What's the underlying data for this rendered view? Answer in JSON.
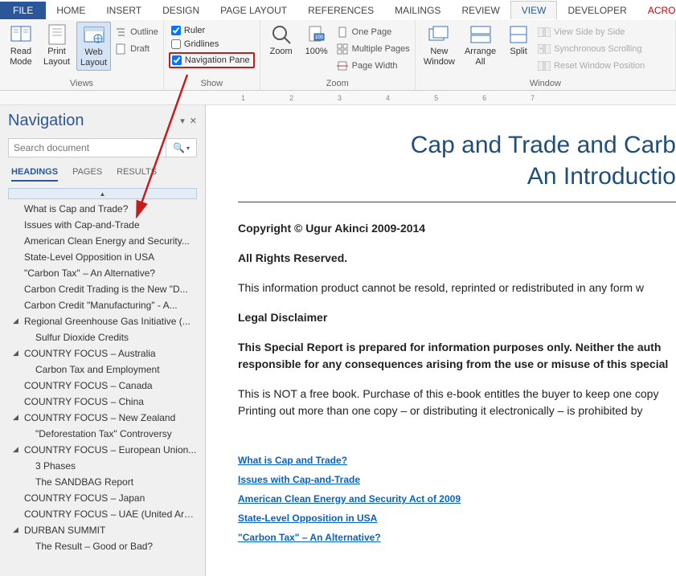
{
  "tabs": {
    "file": "FILE",
    "home": "HOME",
    "insert": "INSERT",
    "design": "DESIGN",
    "page_layout": "PAGE LAYOUT",
    "references": "REFERENCES",
    "mailings": "MAILINGS",
    "review": "REVIEW",
    "view": "VIEW",
    "developer": "DEVELOPER",
    "acrobat": "ACROBAT"
  },
  "ribbon": {
    "views": {
      "read_mode": "Read\nMode",
      "print_layout": "Print\nLayout",
      "web_layout": "Web\nLayout",
      "outline": "Outline",
      "draft": "Draft",
      "label": "Views"
    },
    "show": {
      "ruler": "Ruler",
      "gridlines": "Gridlines",
      "nav_pane": "Navigation Pane",
      "label": "Show"
    },
    "zoom": {
      "zoom": "Zoom",
      "pct": "100%",
      "one_page": "One Page",
      "multi_pages": "Multiple Pages",
      "page_width": "Page Width",
      "label": "Zoom"
    },
    "window": {
      "new_window": "New\nWindow",
      "arrange_all": "Arrange\nAll",
      "split": "Split",
      "side_by_side": "View Side by Side",
      "sync_scroll": "Synchronous Scrolling",
      "reset_pos": "Reset Window Position",
      "label": "Window"
    }
  },
  "ruler_marks": [
    "1",
    "2",
    "3",
    "4",
    "5",
    "6",
    "7"
  ],
  "nav": {
    "title": "Navigation",
    "search_placeholder": "Search document",
    "tabs": {
      "headings": "HEADINGS",
      "pages": "PAGES",
      "results": "RESULTS"
    },
    "items": [
      {
        "label": "What is Cap and Trade?",
        "level": 0
      },
      {
        "label": "Issues with Cap-and-Trade",
        "level": 0
      },
      {
        "label": "American Clean Energy and Security...",
        "level": 0
      },
      {
        "label": "State-Level Opposition in USA",
        "level": 0
      },
      {
        "label": "\"Carbon Tax\" – An Alternative?",
        "level": 0
      },
      {
        "label": "Carbon Credit Trading is the New \"D...",
        "level": 0
      },
      {
        "label": "Carbon Credit \"Manufacturing\" - A...",
        "level": 0
      },
      {
        "label": "Regional Greenhouse Gas Initiative (...",
        "level": 0,
        "caret": true
      },
      {
        "label": "Sulfur Dioxide Credits",
        "level": 1
      },
      {
        "label": "COUNTRY FOCUS – Australia",
        "level": 0,
        "caret": true
      },
      {
        "label": "Carbon Tax and Employment",
        "level": 1
      },
      {
        "label": "COUNTRY FOCUS – Canada",
        "level": 0
      },
      {
        "label": "COUNTRY FOCUS – China",
        "level": 0
      },
      {
        "label": "COUNTRY FOCUS – New Zealand",
        "level": 0,
        "caret": true
      },
      {
        "label": "\"Deforestation Tax\" Controversy",
        "level": 1
      },
      {
        "label": "COUNTRY FOCUS – European Union...",
        "level": 0,
        "caret": true
      },
      {
        "label": "3 Phases",
        "level": 1
      },
      {
        "label": "The SANDBAG Report",
        "level": 1
      },
      {
        "label": "COUNTRY FOCUS – Japan",
        "level": 0
      },
      {
        "label": "COUNTRY FOCUS – UAE (United Ara...",
        "level": 0
      },
      {
        "label": "DURBAN SUMMIT",
        "level": 0,
        "caret": true
      },
      {
        "label": "The Result – Good or Bad?",
        "level": 1
      }
    ]
  },
  "doc": {
    "title_l1": "Cap and Trade and Carb",
    "title_l2": "An Introductio",
    "p1": "Copyright © Ugur Akinci 2009-2014",
    "p2": "All Rights Reserved.",
    "p3": "This information product cannot be resold, reprinted or redistributed in any form w",
    "p4": "Legal Disclaimer",
    "p5": "This Special Report is prepared for information purposes only. Neither the auth responsible for any consequences arising from the use or misuse of this special ",
    "p6": "This is NOT a free book. Purchase of this e-book entitles the buyer to keep one copy Printing out more than one copy – or distributing it electronically – is prohibited by",
    "links": [
      "What is Cap and Trade?",
      "Issues with Cap-and-Trade",
      "American Clean Energy and Security Act of 2009",
      "State-Level Opposition in USA",
      "\"Carbon Tax\" – An Alternative?"
    ]
  }
}
